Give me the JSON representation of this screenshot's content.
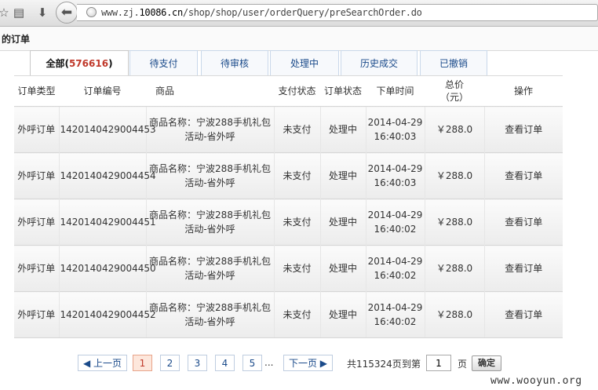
{
  "browser": {
    "url_prefix": "www.zj.",
    "url_domain": "10086.cn",
    "url_path": "/shop/shop/user/orderQuery/preSearchOrder.do"
  },
  "page": {
    "title": "的订单"
  },
  "tabs": [
    {
      "label": "全部(",
      "count": "576616",
      "suffix": ")"
    },
    {
      "label": "待支付"
    },
    {
      "label": "待审核"
    },
    {
      "label": "处理中"
    },
    {
      "label": "历史成交"
    },
    {
      "label": "已撤销"
    }
  ],
  "table": {
    "headers": [
      "订单类型",
      "订单编号",
      "商品",
      "支付状态",
      "订单状态",
      "下单时间",
      "总价\n（元）",
      "操作"
    ],
    "rows": [
      {
        "type": "外呼订单",
        "id": "1420140429004453",
        "goods": "商品名称：宁波288手机礼包活动-省外呼",
        "pay": "未支付",
        "status": "处理中",
        "date": "2014-04-29",
        "time": "16:40:03",
        "price": "￥288.0",
        "action": "查看订单"
      },
      {
        "type": "外呼订单",
        "id": "1420140429004454",
        "goods": "商品名称：宁波288手机礼包活动-省外呼",
        "pay": "未支付",
        "status": "处理中",
        "date": "2014-04-29",
        "time": "16:40:03",
        "price": "￥288.0",
        "action": "查看订单"
      },
      {
        "type": "外呼订单",
        "id": "1420140429004451",
        "goods": "商品名称：宁波288手机礼包活动-省外呼",
        "pay": "未支付",
        "status": "处理中",
        "date": "2014-04-29",
        "time": "16:40:02",
        "price": "￥288.0",
        "action": "查看订单"
      },
      {
        "type": "外呼订单",
        "id": "1420140429004450",
        "goods": "商品名称：宁波288手机礼包活动-省外呼",
        "pay": "未支付",
        "status": "处理中",
        "date": "2014-04-29",
        "time": "16:40:02",
        "price": "￥288.0",
        "action": "查看订单"
      },
      {
        "type": "外呼订单",
        "id": "1420140429004452",
        "goods": "商品名称：宁波288手机礼包活动-省外呼",
        "pay": "未支付",
        "status": "处理中",
        "date": "2014-04-29",
        "time": "16:40:02",
        "price": "￥288.0",
        "action": "查看订单"
      }
    ]
  },
  "pagination": {
    "prev": "◀ 上一页",
    "pages": [
      "1",
      "2",
      "3",
      "4",
      "5"
    ],
    "current": "1",
    "ellipsis": "...",
    "next": "下一页 ▶",
    "total": "共115324页",
    "goto_prefix": "到第",
    "goto_value": "1",
    "goto_suffix": "页",
    "confirm": "确定"
  },
  "watermark": "www.wooyun.org"
}
